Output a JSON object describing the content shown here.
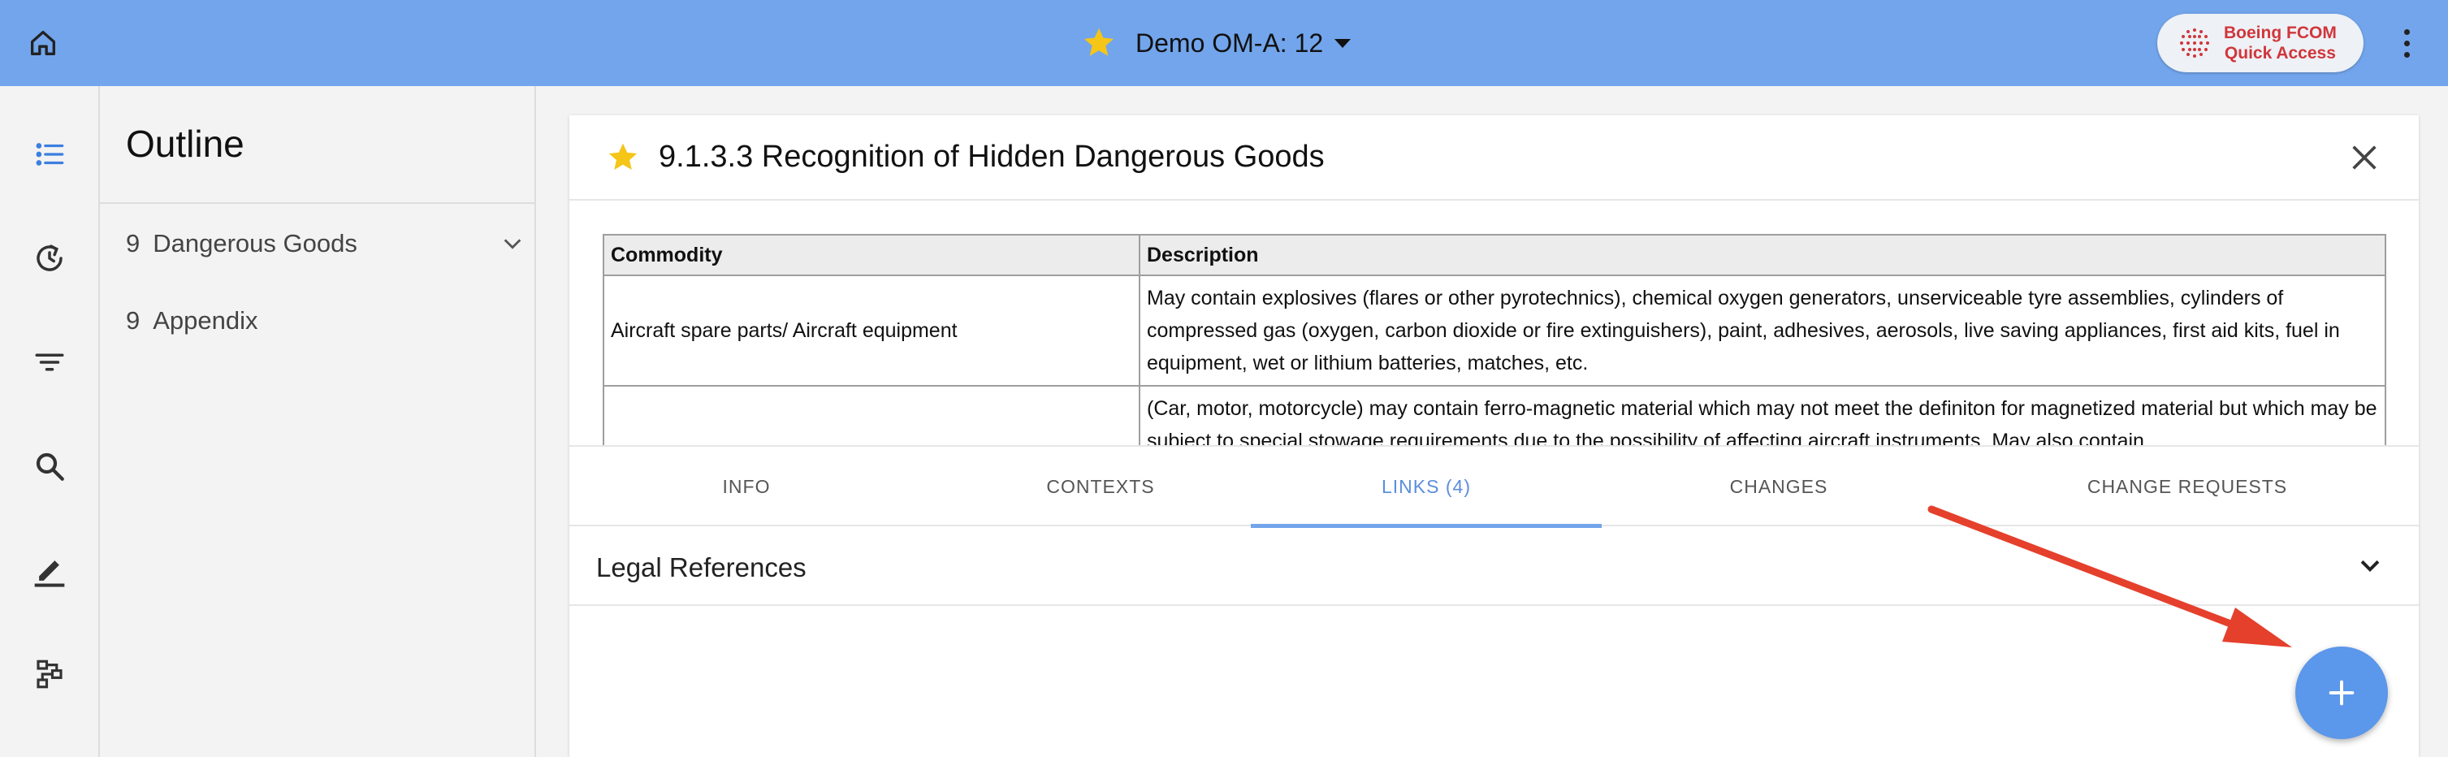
{
  "header": {
    "title": "Demo OM-A: 12",
    "fcom_button": {
      "line1": "Boeing FCOM",
      "line2": "Quick Access"
    },
    "icons": [
      "home-icon",
      "star-icon",
      "caret-down-icon",
      "more-vert-icon"
    ]
  },
  "rail": {
    "icons": [
      "toc-icon",
      "history-icon",
      "filter-icon",
      "search-icon",
      "edit-icon",
      "workflow-icon"
    ],
    "active": "toc-icon",
    "accent": "#3b7fe0"
  },
  "outline": {
    "title": "Outline",
    "items": [
      {
        "num": "9",
        "label": "Dangerous Goods"
      },
      {
        "num": "9",
        "label": "Appendix"
      }
    ]
  },
  "document": {
    "title": "9.1.3.3 Recognition of Hidden Dangerous Goods",
    "table": {
      "headers": [
        "Commodity",
        "Description"
      ],
      "rows": [
        {
          "commodity": "Aircraft spare parts/ Aircraft equipment",
          "description": "May contain explosives (flares or other pyrotechnics), chemical oxygen generators, unserviceable tyre assemblies, cylinders of compressed gas (oxygen, carbon dioxide or fire extinguishers), paint, adhesives, aerosols, live saving appliances, first aid kits, fuel in equipment, wet or lithium batteries, matches, etc."
        },
        {
          "commodity": "",
          "description": "(Car, motor, motorcycle) may contain ferro-magnetic material which may not meet the definiton for magnetized material but which may be subject to special stowage requirements due to the possibility of affecting aircraft instruments. May also contain"
        }
      ]
    },
    "tabs": [
      {
        "label": "INFO",
        "active": false
      },
      {
        "label": "CONTEXTS",
        "active": false
      },
      {
        "label": "LINKS (4)",
        "active": true
      },
      {
        "label": "CHANGES",
        "active": false
      },
      {
        "label": "CHANGE REQUESTS",
        "active": false
      }
    ],
    "section": {
      "label": "Legal References"
    }
  },
  "colors": {
    "topbar": "#72a5eb",
    "star": "#f5c518",
    "fab": "#5b97ea",
    "annotation_arrow": "#e5402c",
    "fcom_text": "#d0363b"
  }
}
